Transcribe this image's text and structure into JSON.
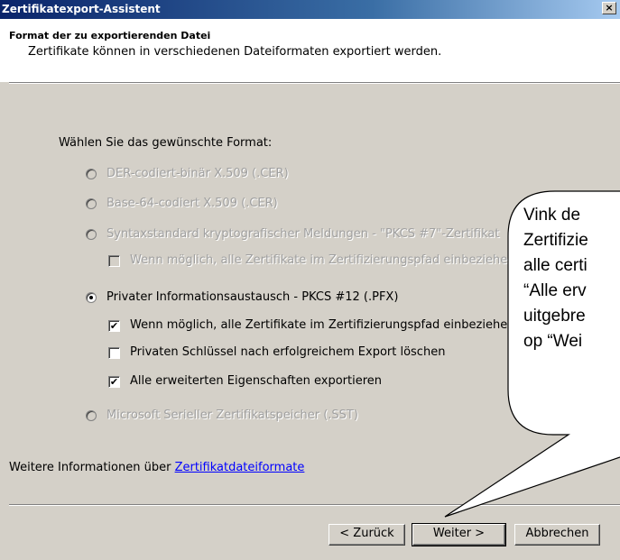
{
  "window": {
    "title": "Zertifikatexport-Assistent",
    "close_label": "×"
  },
  "header": {
    "title": "Format der zu exportierenden Datei",
    "subtitle": "Zertifikate können in verschiedenen Dateiformaten exportiert werden."
  },
  "prompt": "Wählen Sie das gewünschte Format:",
  "formats": [
    {
      "label": "DER-codiert-binär X.509 (.CER)",
      "selected": false,
      "enabled": false
    },
    {
      "label": "Base-64-codiert X.509 (.CER)",
      "selected": false,
      "enabled": false
    },
    {
      "label": "Syntaxstandard kryptografischer Meldungen - \"PKCS #7\"-Zertifikat",
      "selected": false,
      "enabled": false
    },
    {
      "label": "Privater Informationsaustausch - PKCS #12 (.PFX)",
      "selected": true,
      "enabled": true
    },
    {
      "label": "Microsoft Serieller Zertifikatspeicher (.SST)",
      "selected": false,
      "enabled": false
    }
  ],
  "pkcs7_option": {
    "label": "Wenn möglich, alle Zertifikate im Zertifizierungspfad einbeziehe",
    "checked": false,
    "enabled": false
  },
  "pkcs12_options": [
    {
      "label": "Wenn möglich, alle Zertifikate im Zertifizierungspfad einbeziehe",
      "checked": true
    },
    {
      "label": "Privaten Schlüssel nach erfolgreichem Export löschen",
      "checked": false
    },
    {
      "label": "Alle erweiterten Eigenschaften exportieren",
      "checked": true
    }
  ],
  "more_info": {
    "prefix": "Weitere Informationen über ",
    "link": "Zertifikatdateiformate"
  },
  "buttons": {
    "back": "< Zurück",
    "next": "Weiter >",
    "cancel": "Abbrechen"
  },
  "callout": {
    "lines": [
      "Vink de",
      "Zertifizie",
      "alle certi",
      "“Alle erv",
      "uitgebre",
      "op “Wei"
    ]
  },
  "check_mark": "✔"
}
